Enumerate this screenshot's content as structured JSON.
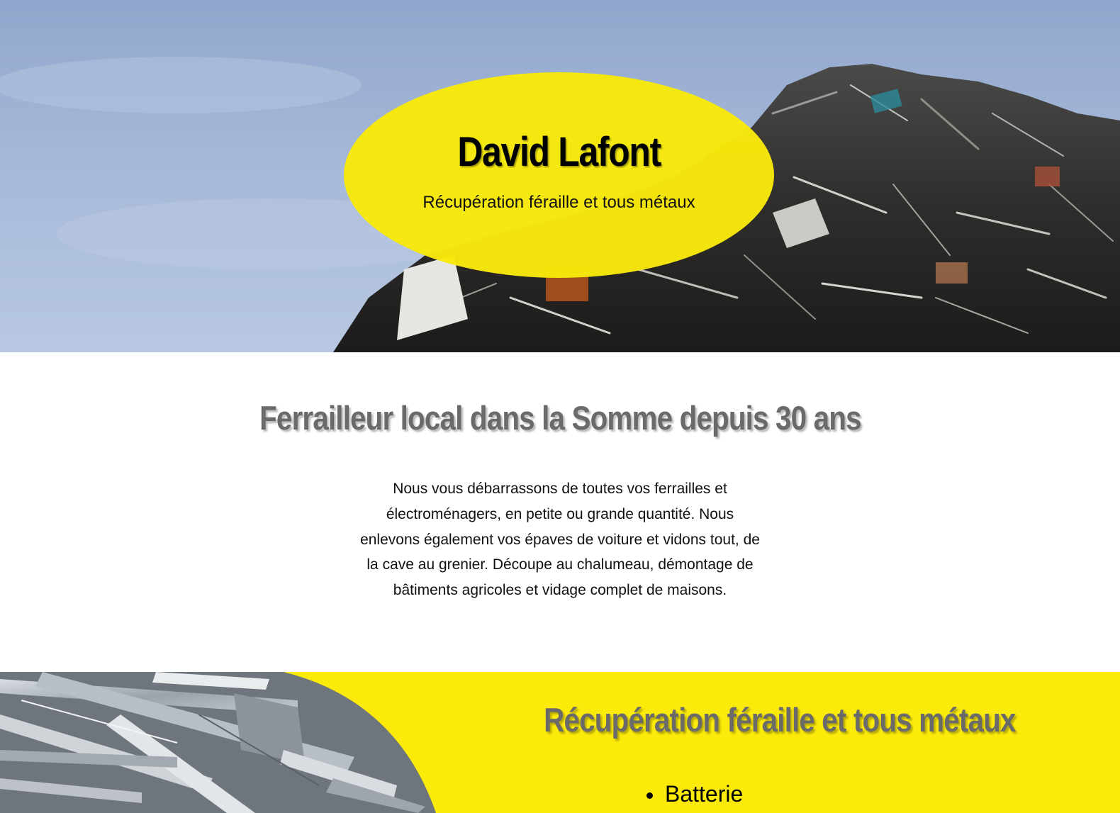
{
  "hero": {
    "title": "David Lafont",
    "subtitle": "Récupération féraille et tous métaux",
    "background_image": "scrap-metal-pile-photo",
    "oval_color": "#f8e90a"
  },
  "intro": {
    "title": "Ferrailleur local dans la Somme depuis 30 ans",
    "text": "Nous vous débarrassons de toutes vos ferrailles et électroménagers, en petite ou grande quantité. Nous enlevons également vos épaves de voiture et vidons tout, de la cave au grenier. Découpe au chalumeau, démontage de bâtiments agricoles et vidage complet de maisons."
  },
  "services": {
    "title": "Récupération féraille et tous métaux",
    "image": "aluminium-scrap-photo",
    "background_color": "#fbea0a",
    "items": [
      "Batterie"
    ]
  }
}
